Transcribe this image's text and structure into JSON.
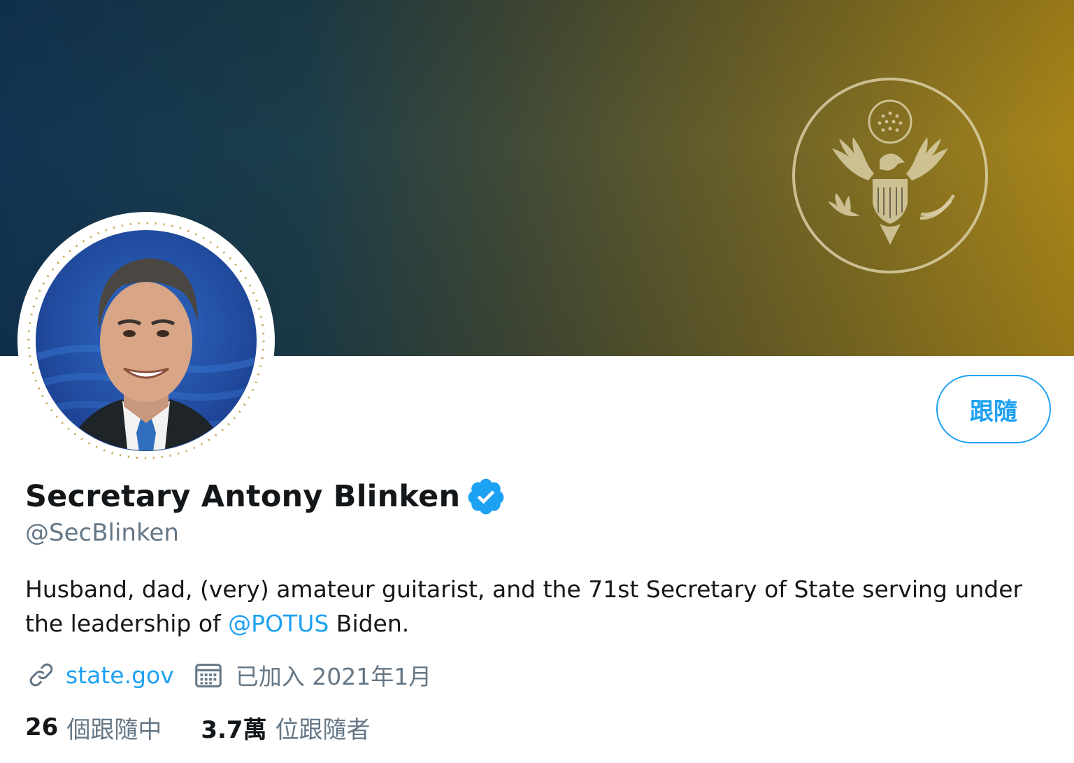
{
  "profile": {
    "display_name": "Secretary Antony Blinken",
    "handle": "@SecBlinken",
    "verified_icon": "verified-badge-icon",
    "bio_text": "Husband, dad, (very) amateur guitarist, and the 71st Secretary of State serving under the leadership of ",
    "bio_mention": "@POTUS",
    "bio_suffix": " Biden.",
    "website": "state.gov",
    "joined": "已加入 2021年1月"
  },
  "actions": {
    "follow_label": "跟隨"
  },
  "stats": {
    "following_count": "26",
    "following_label": "個跟隨中",
    "followers_count": "3.7萬",
    "followers_label": "位跟隨者"
  },
  "icons": {
    "link": "link-icon",
    "calendar": "calendar-icon"
  },
  "colors": {
    "accent": "#1da1f2",
    "secondary_text": "#657786",
    "primary_text": "#14171a",
    "banner_left": "#123452",
    "banner_right": "#a9861a"
  }
}
